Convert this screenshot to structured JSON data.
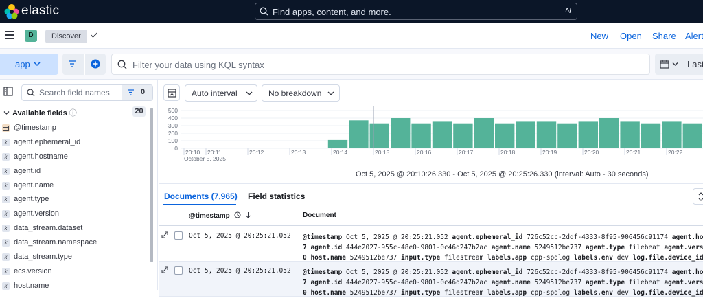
{
  "header": {
    "brand": "elastic",
    "search_placeholder": "Find apps, content, and more.",
    "shortcut": "^/"
  },
  "appbar": {
    "avatar_letter": "D",
    "breadcrumb": "Discover",
    "links": [
      "New",
      "Open",
      "Share",
      "Alert"
    ]
  },
  "querybar": {
    "data_view": "app",
    "kql_placeholder": "Filter your data using KQL syntax",
    "date_label": "Last"
  },
  "sidebar": {
    "search_placeholder": "Search field names",
    "filter_count": "0",
    "available_label": "Available fields",
    "available_count": "20",
    "fields": [
      {
        "name": "@timestamp",
        "type": "date"
      },
      {
        "name": "agent.ephemeral_id",
        "type": "k"
      },
      {
        "name": "agent.hostname",
        "type": "k"
      },
      {
        "name": "agent.id",
        "type": "k"
      },
      {
        "name": "agent.name",
        "type": "k"
      },
      {
        "name": "agent.type",
        "type": "k"
      },
      {
        "name": "agent.version",
        "type": "k"
      },
      {
        "name": "data_stream.dataset",
        "type": "k"
      },
      {
        "name": "data_stream.namespace",
        "type": "k"
      },
      {
        "name": "data_stream.type",
        "type": "k"
      },
      {
        "name": "ecs.version",
        "type": "k"
      },
      {
        "name": "host.name",
        "type": "k"
      }
    ]
  },
  "toolbar": {
    "interval": "Auto interval",
    "breakdown": "No breakdown"
  },
  "chart_data": {
    "type": "bar",
    "y_ticks": [
      "500",
      "400",
      "300",
      "200",
      "100",
      "0"
    ],
    "ylim": [
      0,
      500
    ],
    "x_ticks": [
      "20:10",
      "20:11",
      "20:12",
      "20:13",
      "20:14",
      "20:15",
      "20:16",
      "20:17",
      "20:18",
      "20:19",
      "20:20",
      "20:21",
      "20:22"
    ],
    "x_sublabel": "October 5, 2025",
    "values": [
      0,
      0,
      0,
      0,
      0,
      0,
      0,
      110,
      370,
      330,
      400,
      330,
      360,
      330,
      400,
      330,
      360,
      360,
      330,
      360,
      400,
      360,
      330,
      360,
      330
    ],
    "bar_color": "#54b399",
    "time_range": "Oct 5, 2025 @ 20:10:26.330 - Oct 5, 2025 @ 20:25:26.330 (interval: Auto - 30 seconds)"
  },
  "tabs": {
    "documents": "Documents (7,965)",
    "field_stats": "Field statistics"
  },
  "grid": {
    "col_timestamp": "@timestamp",
    "col_document": "Document",
    "rows": [
      {
        "timestamp": "Oct 5, 2025 @ 20:25:21.052",
        "line1": [
          [
            "@timestamp",
            "Oct 5, 2025 @ 20:25:21.052"
          ],
          [
            "agent.ephemeral_id",
            "726c52cc-2ddf-4333-8f95-906456c91174"
          ],
          [
            "agent.hos",
            ""
          ]
        ],
        "line2": [
          [
            "7 agent.id",
            "444e2027-955c-48e0-9801-0c46d247b2ac"
          ],
          [
            "agent.name",
            "5249512be737"
          ],
          [
            "agent.type",
            "filebeat"
          ],
          [
            "agent.versi",
            ""
          ]
        ],
        "line3": [
          [
            "0 host.name",
            "5249512be737"
          ],
          [
            "input.type",
            "filestream"
          ],
          [
            "labels.app",
            "cpp-spdlog"
          ],
          [
            "labels.env",
            "dev"
          ],
          [
            "log.file.device_id",
            ""
          ]
        ]
      },
      {
        "timestamp": "Oct 5, 2025 @ 20:25:21.052",
        "line1": [
          [
            "@timestamp",
            "Oct 5, 2025 @ 20:25:21.052"
          ],
          [
            "agent.ephemeral_id",
            "726c52cc-2ddf-4333-8f95-906456c91174"
          ],
          [
            "agent.hos",
            ""
          ]
        ],
        "line2": [
          [
            "7 agent.id",
            "444e2027-955c-48e0-9801-0c46d247b2ac"
          ],
          [
            "agent.name",
            "5249512be737"
          ],
          [
            "agent.type",
            "filebeat"
          ],
          [
            "agent.versi",
            ""
          ]
        ],
        "line3": [
          [
            "0 host.name",
            "5249512be737"
          ],
          [
            "input.type",
            "filestream"
          ],
          [
            "labels.app",
            "cpp-spdlog"
          ],
          [
            "labels.env",
            "dev"
          ],
          [
            "log.file.device_id",
            ""
          ]
        ]
      }
    ]
  }
}
